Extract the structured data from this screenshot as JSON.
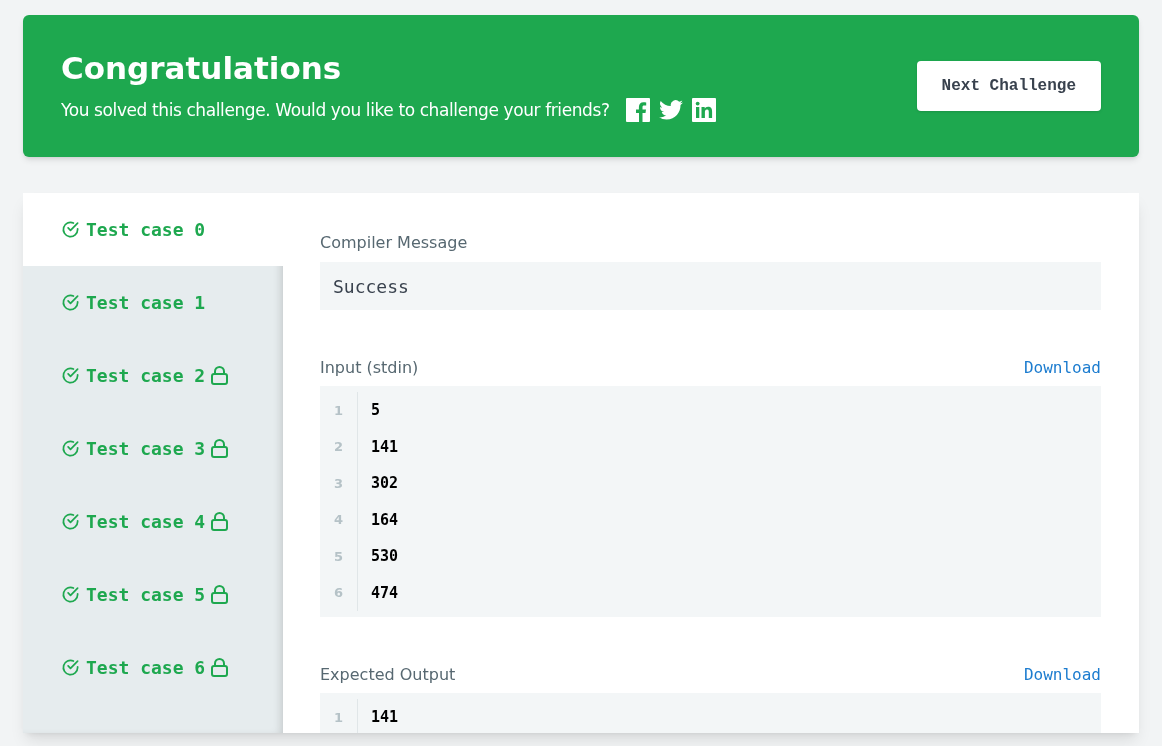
{
  "banner": {
    "title": "Congratulations",
    "message": "You solved this challenge. Would you like to challenge your friends?",
    "share": [
      {
        "kind": "facebook"
      },
      {
        "kind": "twitter"
      },
      {
        "kind": "linkedin"
      }
    ],
    "button": "Next Challenge"
  },
  "test_cases": [
    {
      "label": "Test case 0",
      "passed": true,
      "locked": false,
      "selected": true
    },
    {
      "label": "Test case 1",
      "passed": true,
      "locked": false,
      "selected": false
    },
    {
      "label": "Test case 2",
      "passed": true,
      "locked": true,
      "selected": false
    },
    {
      "label": "Test case 3",
      "passed": true,
      "locked": true,
      "selected": false
    },
    {
      "label": "Test case 4",
      "passed": true,
      "locked": true,
      "selected": false
    },
    {
      "label": "Test case 5",
      "passed": true,
      "locked": true,
      "selected": false
    },
    {
      "label": "Test case 6",
      "passed": true,
      "locked": true,
      "selected": false
    }
  ],
  "compiler": {
    "label": "Compiler Message",
    "value": "Success"
  },
  "sections": [
    {
      "label": "Input (stdin)",
      "download": "Download",
      "lines": [
        {
          "number": "1",
          "text": "5"
        },
        {
          "number": "2",
          "text": "141"
        },
        {
          "number": "3",
          "text": "302"
        },
        {
          "number": "4",
          "text": "164"
        },
        {
          "number": "5",
          "text": "530"
        },
        {
          "number": "6",
          "text": "474"
        }
      ]
    },
    {
      "label": "Expected Output",
      "download": "Download",
      "lines": [
        {
          "number": "1",
          "text": "141"
        }
      ]
    }
  ]
}
